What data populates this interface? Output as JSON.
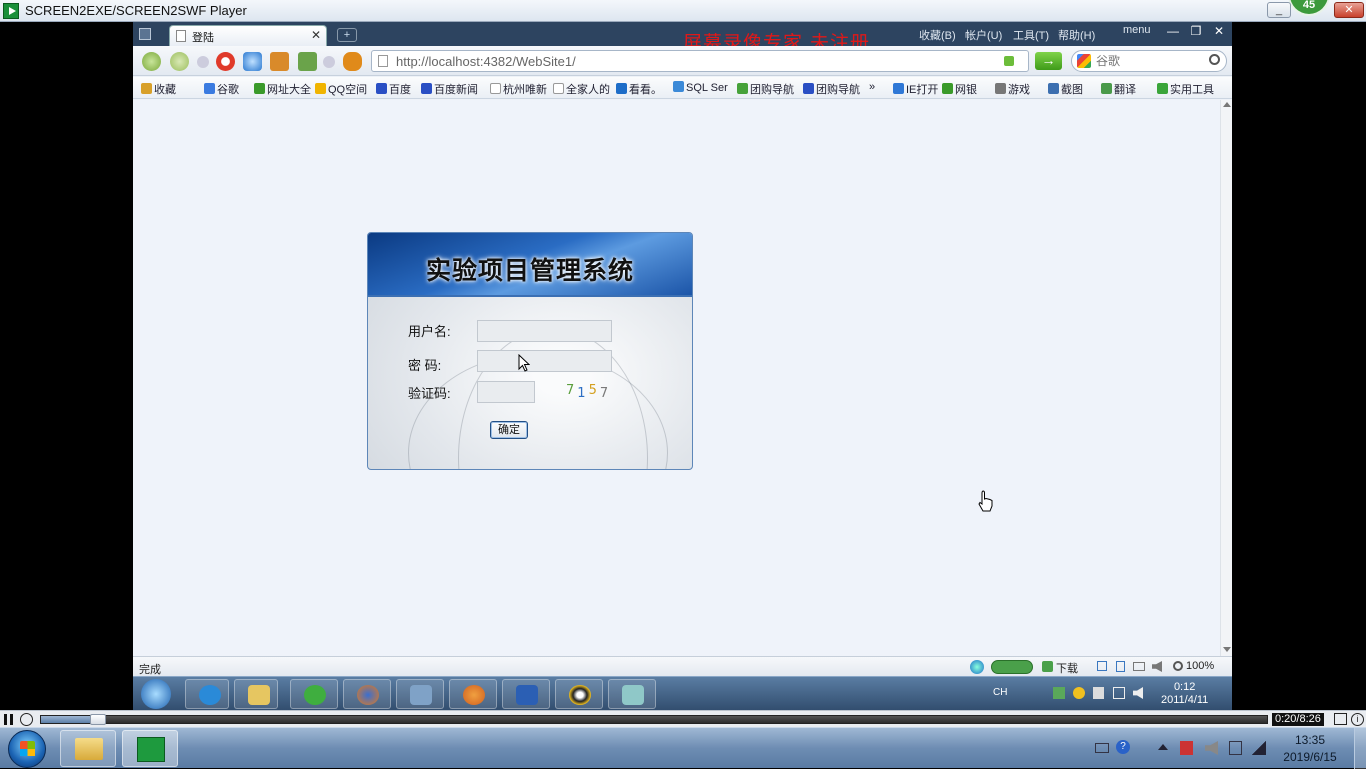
{
  "player": {
    "title": "SCREEN2EXE/SCREEN2SWF Player",
    "badge": "45",
    "minimize": "_",
    "close": "✕",
    "seek_time": "0:20/8:26",
    "progress_fraction": 0.04
  },
  "browser": {
    "tab_label": "登陆",
    "tab_close": "✕",
    "new_tab": "+",
    "menu": [
      "收藏(B)",
      "帐户(U)",
      "工具(T)",
      "帮助(H)",
      "menu"
    ],
    "watermark": "屏幕录像专家  未注册",
    "window_buttons": [
      "—",
      "❐",
      "✕"
    ],
    "address": "http://localhost:4382/WebSite1/",
    "go_label": "→",
    "search_placeholder": "谷歌",
    "favorites": [
      {
        "label": "收藏",
        "color": "#d8a02a"
      },
      {
        "label": "谷歌",
        "color": "#3b7be0"
      },
      {
        "label": "网址大全",
        "color": "#3a9a2a"
      },
      {
        "label": "QQ空间",
        "color": "#f0b400"
      },
      {
        "label": "百度",
        "color": "#2a4fc4"
      },
      {
        "label": "百度新闻",
        "color": "#2a4fc4"
      },
      {
        "label": "杭州唯新",
        "color": "#ffffff"
      },
      {
        "label": "全家人的",
        "color": "#ffffff"
      },
      {
        "label": "看看。",
        "color": "#1d6dc8"
      },
      {
        "label": "SQL Ser",
        "color": "#3c8ad8"
      },
      {
        "label": "团购导航",
        "color": "#46a23a"
      },
      {
        "label": "团购导航",
        "color": "#2a4fc4"
      },
      {
        "label": "»",
        "color": ""
      },
      {
        "label": "IE打开",
        "color": "#2f78d6"
      },
      {
        "label": "网银",
        "color": "#3a9a2a"
      },
      {
        "label": "游戏",
        "color": "#777777"
      },
      {
        "label": "截图",
        "color": "#3c6fb0"
      },
      {
        "label": "翻译",
        "color": "#4a9a4a"
      },
      {
        "label": "实用工具",
        "color": "#3aa53a"
      }
    ],
    "status_text": "完成",
    "status_right": {
      "download": "下载",
      "zoom": "100%"
    }
  },
  "login": {
    "title": "实验项目管理系统",
    "username_label": "用户名:",
    "password_label": "密  码:",
    "captcha_label": "验证码:",
    "captcha_text": "7157",
    "captcha_colors": [
      "#5a9e3c",
      "#2d6fc4",
      "#d4a020",
      "#7a7a7a"
    ],
    "confirm_label": "确定",
    "username_value": "",
    "password_value": "",
    "captcha_value": ""
  },
  "inner_taskbar": {
    "tray": "CH",
    "time": "0:12",
    "date": "2011/4/11"
  },
  "taskbar": {
    "time": "13:35",
    "date": "2019/6/15"
  }
}
